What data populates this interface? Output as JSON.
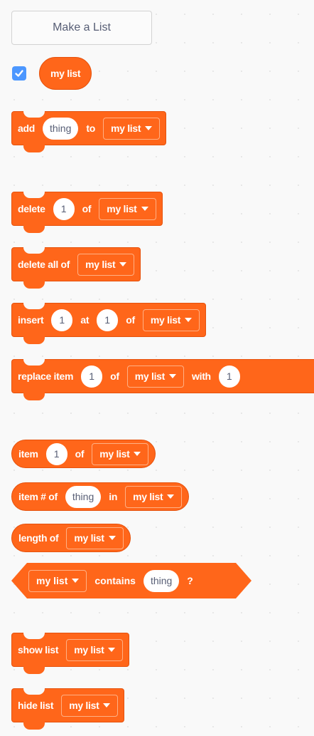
{
  "make_list_button": "Make a List",
  "list_reporter": {
    "label": "my list",
    "checked": true
  },
  "list_name": "my list",
  "blocks": {
    "add": {
      "word1": "add",
      "input": "thing",
      "word2": "to"
    },
    "delete": {
      "word1": "delete",
      "input": "1",
      "word2": "of"
    },
    "delete_all": {
      "word1": "delete all of"
    },
    "insert": {
      "word1": "insert",
      "input1": "1",
      "word2": "at",
      "input2": "1",
      "word3": "of"
    },
    "replace": {
      "word1": "replace item",
      "input1": "1",
      "word2": "of",
      "word3": "with",
      "input2": "1"
    },
    "item": {
      "word1": "item",
      "input": "1",
      "word2": "of"
    },
    "item_index": {
      "word1": "item # of",
      "input": "thing",
      "word2": "in"
    },
    "length": {
      "word1": "length of"
    },
    "contains": {
      "word1": "contains",
      "input": "thing",
      "suffix": "?"
    },
    "show": {
      "word1": "show list"
    },
    "hide": {
      "word1": "hide list"
    }
  },
  "colors": {
    "lists_category": "#ff661a",
    "checkbox": "#4c97ff",
    "input_text": "#575e75"
  }
}
